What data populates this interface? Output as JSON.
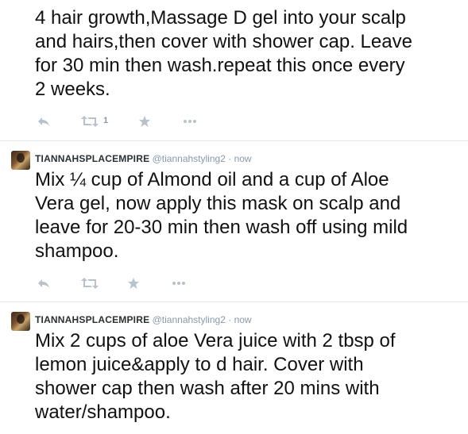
{
  "tweets": [
    {
      "name": "",
      "handle": "",
      "dot": "",
      "time": "",
      "text": "4 hair growth,Massage D gel into your scalp\nand hairs,then cover with shower cap. Leave\nfor 30 min then wash.repeat this once every\n2 weeks.",
      "retweet_count": "1",
      "icons": [
        "reply-icon",
        "retweet-icon",
        "favorite-icon",
        "more-icon"
      ]
    },
    {
      "name": "TIANNAHSPLACEMPIRE",
      "handle": "@tiannahstyling2",
      "dot": "·",
      "time": "now",
      "text": "Mix ¼ cup of Almond oil and a cup of Aloe\nVera gel, now apply this mask on scalp and\nleave for 20-30 min then wash off using mild\nshampoo.",
      "retweet_count": "",
      "icons": [
        "reply-icon",
        "retweet-icon",
        "favorite-icon",
        "more-icon"
      ]
    },
    {
      "name": "TIANNAHSPLACEMPIRE",
      "handle": "@tiannahstyling2",
      "dot": "·",
      "time": "now",
      "text": "Mix 2 cups of aloe Vera juice with 2 tbsp of\nlemon juice&apply to d hair. Cover with\nshower cap then wash after 20 mins with\nwater/shampoo.",
      "retweet_count": "",
      "icons": [
        "reply-icon",
        "retweet-icon",
        "favorite-icon",
        "more-icon"
      ]
    }
  ],
  "colors": {
    "divider": "#e1e8ed",
    "icon": "#b6c2cc",
    "meta": "#8899a6",
    "text": "#111111"
  }
}
